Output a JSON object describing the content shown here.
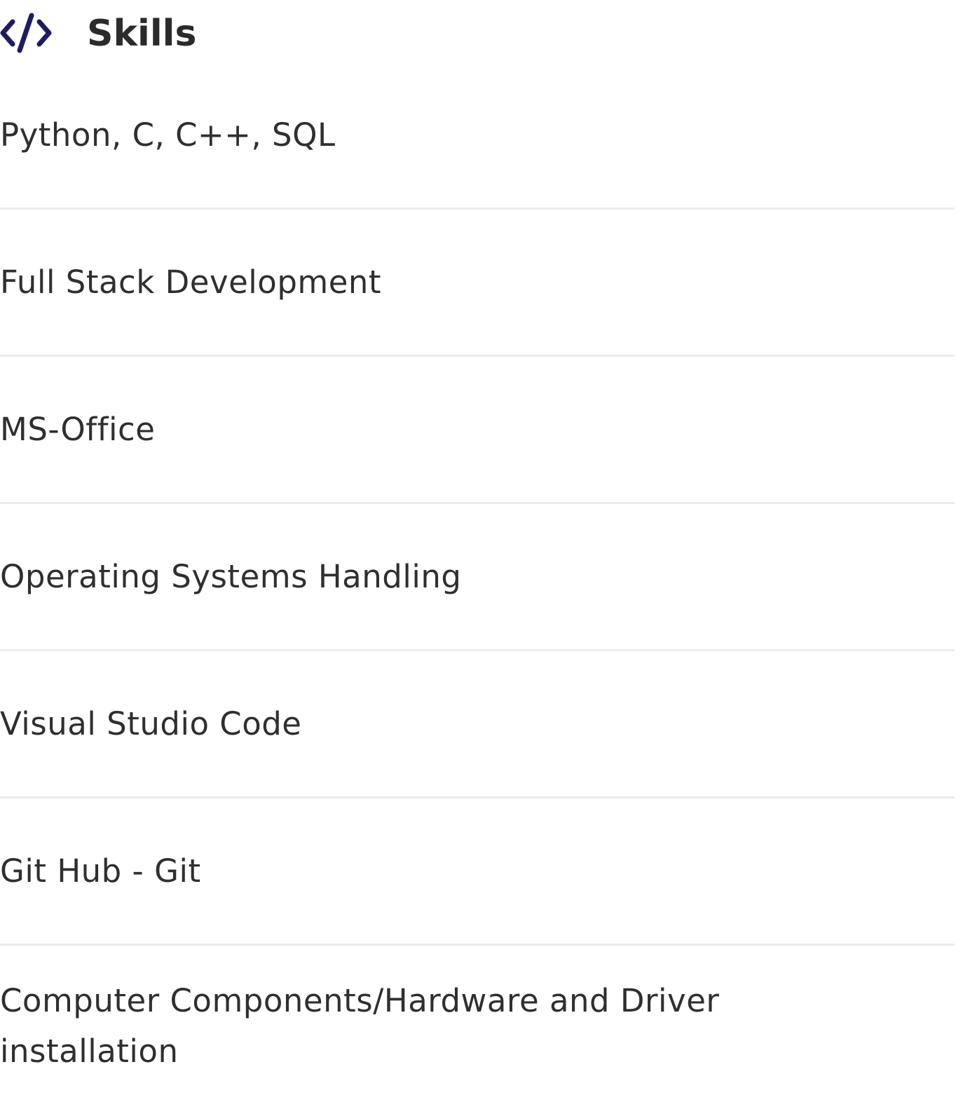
{
  "section": {
    "icon": "code-icon",
    "title": "Skills",
    "accent_color": "#1f1b63"
  },
  "skills": [
    "Python, C, C++, SQL",
    "Full Stack Development",
    "MS-Office",
    "Operating Systems Handling",
    "Visual Studio Code",
    "Git Hub - Git",
    "Computer Components/Hardware and Driver installation"
  ]
}
